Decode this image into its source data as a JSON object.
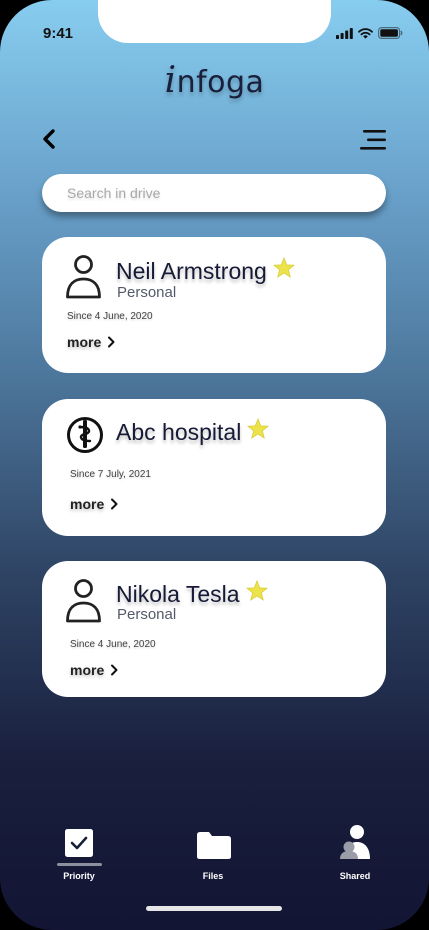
{
  "status_bar": {
    "time": "9:41"
  },
  "app": {
    "logo_prefix": "i",
    "logo_text": "nfoga"
  },
  "header": {
    "back_icon": "chevron-left-icon",
    "menu_icon": "menu-icon"
  },
  "search": {
    "placeholder": "Search in drive",
    "value": ""
  },
  "contacts": [
    {
      "name": "Neil Armstrong",
      "type": "Personal",
      "icon": "person-icon",
      "starred": true,
      "since": "Since 4 June, 2020",
      "more_label": "more"
    },
    {
      "name": "Abc hospital",
      "type": "",
      "icon": "medical-icon",
      "starred": true,
      "since": "Since 7 July, 2021",
      "more_label": "more"
    },
    {
      "name": "Nikola Tesla",
      "type": "Personal",
      "icon": "person-icon",
      "starred": true,
      "since": "Since 4 June, 2020",
      "more_label": "more"
    }
  ],
  "tabbar": {
    "tabs": [
      {
        "label": "Priority",
        "icon": "checkbox-icon",
        "active": true
      },
      {
        "label": "Files",
        "icon": "folder-icon",
        "active": false
      },
      {
        "label": "Shared",
        "icon": "users-icon",
        "active": false
      }
    ]
  },
  "colors": {
    "star": "#ece24a",
    "text_dark": "#171a36",
    "gradient_top": "#87cdef",
    "gradient_bottom": "#121533"
  }
}
